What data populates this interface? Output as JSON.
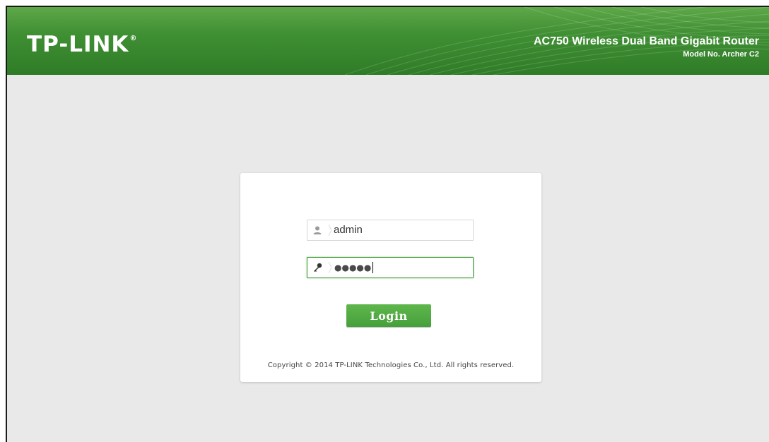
{
  "header": {
    "logo_text": "TP-LINK",
    "logo_mark": "®",
    "product_title": "AC750 Wireless Dual Band Gigabit Router",
    "model": "Model No. Archer C2",
    "colors": {
      "header_green": "#3f8f33",
      "header_light_green": "#5ea848"
    }
  },
  "login": {
    "username_icon": "user-icon",
    "username_value": "admin",
    "password_icon": "key-icon",
    "password_masked": "●●●●●",
    "password_focused": true,
    "login_button": "Login",
    "button_color": "#4aa43d"
  },
  "footer": {
    "copyright": "Copyright © 2014 TP-LINK Technologies Co., Ltd. All rights reserved."
  }
}
